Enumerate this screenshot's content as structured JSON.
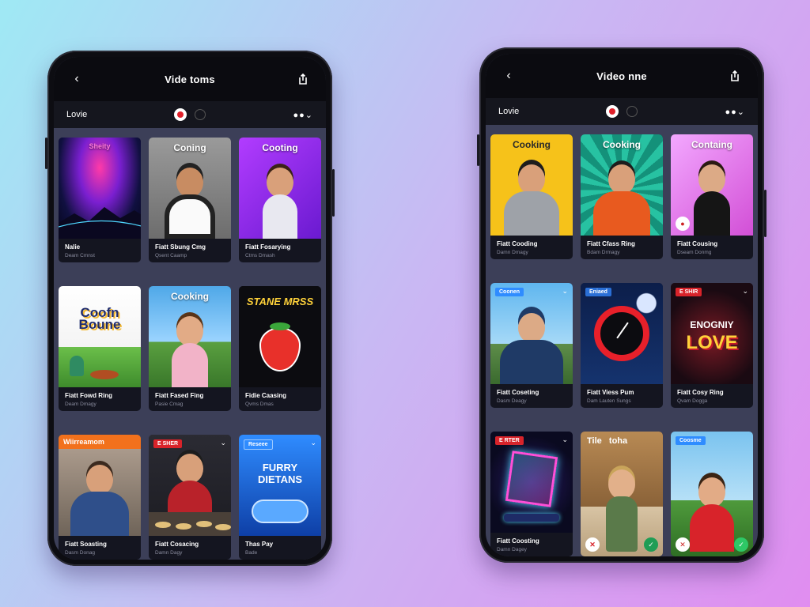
{
  "left_phone": {
    "title": "Vide toms",
    "subtitle": "Lovie",
    "more_label": "●●⌄",
    "cards": [
      {
        "thumb_title": "Sheity",
        "title": "Nalie",
        "sub": "Deam Cmnst",
        "badge": ""
      },
      {
        "thumb_title": "Coning",
        "title": "Fiatt Sbung Cmg",
        "sub": "Qsent Caamp",
        "badge": ""
      },
      {
        "thumb_title": "Cooting",
        "title": "Fiatt Fosarying",
        "sub": "Ctms Dmash",
        "badge": ""
      },
      {
        "thumb_title": "",
        "logo_text": "Coofn Boune",
        "title": "Fiatt Fowd Ring",
        "sub": "Deam Dmagy",
        "badge": ""
      },
      {
        "thumb_title": "Cooking",
        "title": "Fiatt Fased Fing",
        "sub": "Pasie Cmag",
        "badge": ""
      },
      {
        "thumb_title": "",
        "logo_text": "STANE MRSS",
        "title": "Fidie Caasing",
        "sub": "Qvms Dmas",
        "badge": ""
      },
      {
        "thumb_title": "",
        "title": "Fiatt Soasting",
        "sub": "Dasm Donag",
        "badge": "Wiirreamom"
      },
      {
        "thumb_title": "",
        "title": "Fiatt Cosacing",
        "sub": "Damn Dagy",
        "badge": "E SHER"
      },
      {
        "thumb_title": "",
        "logo_text": "FURRY DIETANS",
        "title": "Thas Pay",
        "sub": "Bade",
        "badge": "Reseee"
      }
    ]
  },
  "right_phone": {
    "title": "Video nne",
    "subtitle": "Lovie",
    "more_label": "●●⌄",
    "cards": [
      {
        "thumb_title": "Cooking",
        "title": "Fiatt Cooding",
        "sub": "Damn Dmagy",
        "badge": ""
      },
      {
        "thumb_title": "Cooking",
        "title": "Fiatt Cfass Ring",
        "sub": "Bdam Drmagy",
        "badge": ""
      },
      {
        "thumb_title": "Containg",
        "title": "Fiatt Cousing",
        "sub": "Dseam Donmg",
        "badge": ""
      },
      {
        "thumb_title": "",
        "title": "Fiatt Coseting",
        "sub": "Dasm Deagy",
        "badge": "Coonen"
      },
      {
        "thumb_title": "",
        "title": "Fiatt Viess Pum",
        "sub": "Dam Lauten Sungs",
        "badge": "Eniaed"
      },
      {
        "thumb_title": "",
        "logo_text": "ENOGNIY",
        "logo_text2": "LOVE",
        "title": "Fiatt Cosy Ring",
        "sub": "Qvam Dogga",
        "badge": "E SHIR"
      },
      {
        "thumb_title": "",
        "title": "Fiatt Coosting",
        "sub": "Damn Dagey",
        "badge": "E RTER"
      },
      {
        "thumb_title": "Tile   toha",
        "title": "",
        "sub": "",
        "badge": ""
      },
      {
        "thumb_title": "",
        "title": "",
        "sub": "",
        "badge": "Coosme"
      }
    ]
  }
}
